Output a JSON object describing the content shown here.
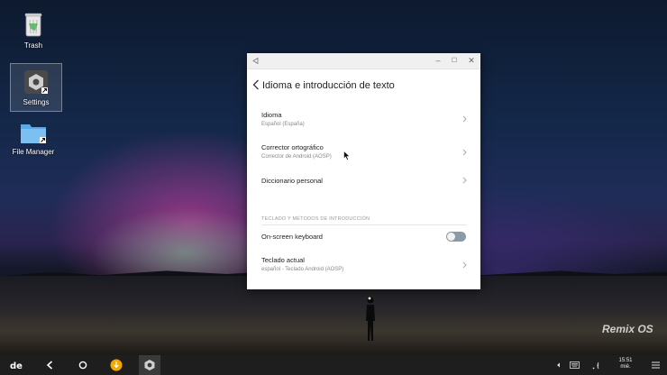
{
  "desktop": {
    "icons": [
      {
        "label": "Trash",
        "icon": "trash-icon"
      },
      {
        "label": "Settings",
        "icon": "settings-gear-icon"
      },
      {
        "label": "File Manager",
        "icon": "folder-icon"
      }
    ],
    "watermark": "Remix OS"
  },
  "window": {
    "title": "Idioma e introducción de texto",
    "items": [
      {
        "title": "Idioma",
        "subtitle": "Español (España)"
      },
      {
        "title": "Corrector ortográfico",
        "subtitle": "Corrector de Android (AOSP)"
      },
      {
        "title": "Diccionario personal",
        "subtitle": ""
      }
    ],
    "section_header": "TECLADO Y MÉTODOS DE INTRODUCCIÓN",
    "keyboard": {
      "title": "On-screen keyboard",
      "enabled": false
    },
    "current_keyboard": {
      "title": "Teclado actual",
      "subtitle": "español - Teclado Android (AOSP)"
    }
  },
  "taskbar": {
    "time": "15:51",
    "day": "mié."
  }
}
